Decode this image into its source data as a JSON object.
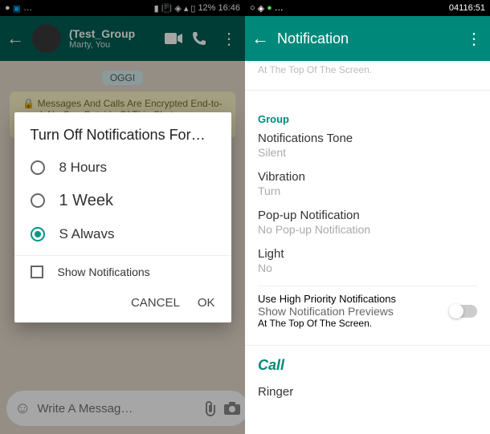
{
  "left": {
    "statusbar": {
      "battery": "12%",
      "time": "16:46"
    },
    "chat": {
      "title": "(Test_Group",
      "subtitle": "Marty, You",
      "date_label": "OGGI",
      "encryption_notice": "Messages And Calls Are Encrypted End-to-end. No One Outside Of This Chat nemmeno WhatsApp, può leggerne o ascoltarne il",
      "input_placeholder": "Write A Messag…"
    },
    "dialog": {
      "title": "Turn Off Notifications For…",
      "options": [
        "8 Hours",
        "1 Week",
        "S Alwavs"
      ],
      "selected_index": 2,
      "checkbox_label": "Show Notifications",
      "cancel": "CANCEL",
      "ok": "OK"
    }
  },
  "right": {
    "statusbar": {
      "time": "04116:51"
    },
    "page_title": "Notification",
    "hint_top": "At The Top Of The Screen.",
    "section_group": "Group",
    "settings": [
      {
        "title": "Notifications Tone",
        "value": "Silent"
      },
      {
        "title": "Vibration",
        "value": "Turn"
      },
      {
        "title": "Pop-up Notification",
        "value": "No Pop-up Notification"
      },
      {
        "title": "Light",
        "value": "No"
      }
    ],
    "priority": {
      "title": "Use High Priority Notifications",
      "subtitle": "Show Notification Previews",
      "hint": "At The Top Of The Screen."
    },
    "call_header": "Call",
    "ringer": {
      "title": "Ringer"
    }
  }
}
